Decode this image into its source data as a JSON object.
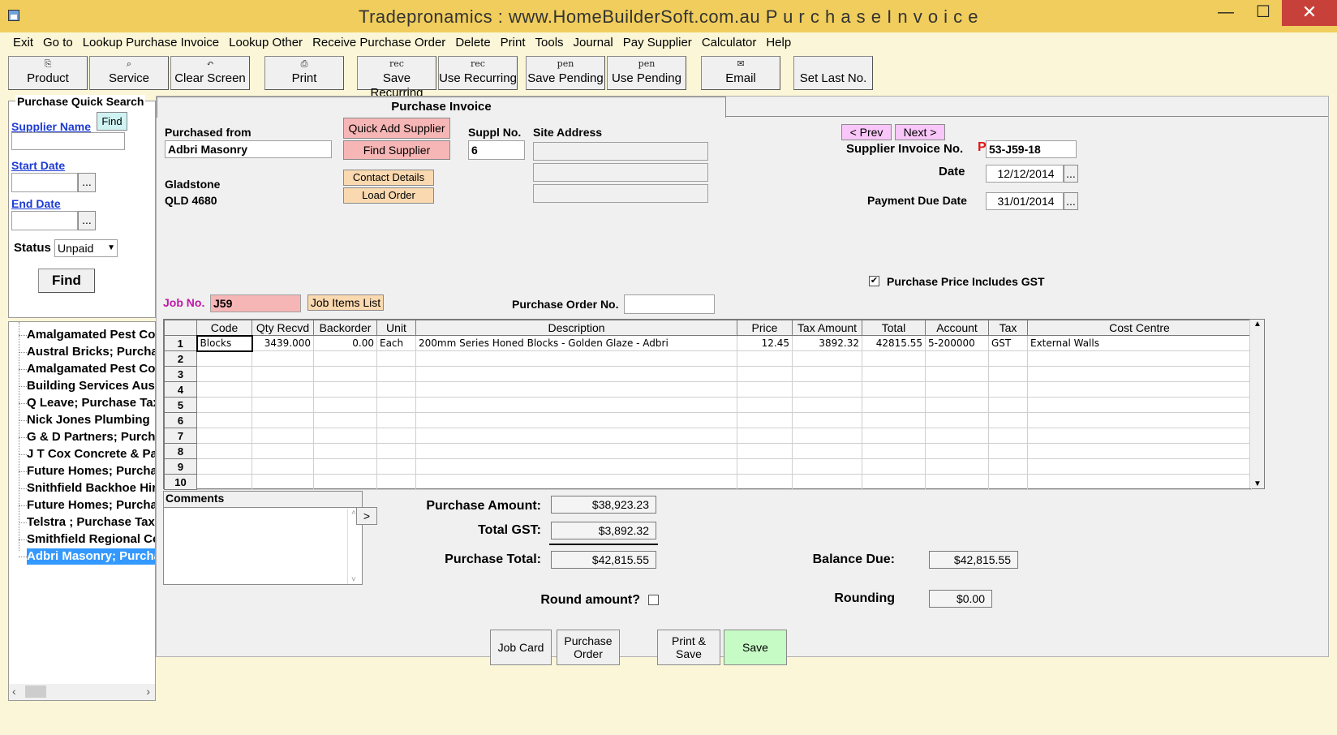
{
  "window": {
    "title": "Tradepronamics :   www.HomeBuilderSoft.com.au     P u r c h a s e   I n v o i c e",
    "minimize": "—",
    "maximize": "☐",
    "close": "✕"
  },
  "menu": [
    "Exit",
    "Go to",
    "Lookup Purchase Invoice",
    "Lookup Other",
    "Receive Purchase Order",
    "Delete",
    "Print",
    "Tools",
    "Journal",
    "Pay Supplier",
    "Calculator",
    "Help"
  ],
  "toolbar": [
    {
      "label": "Product",
      "icon": "⎘"
    },
    {
      "label": "Service",
      "icon": "⌕"
    },
    {
      "label": "Clear Screen",
      "icon": "↶"
    },
    {
      "label": "Print",
      "icon": "⎙"
    },
    {
      "label": "Save Recurring",
      "icon": "rec"
    },
    {
      "label": "Use Recurring",
      "icon": "rec"
    },
    {
      "label": "Save Pending",
      "icon": "pen"
    },
    {
      "label": "Use Pending",
      "icon": "pen"
    },
    {
      "label": "Email",
      "icon": "✉"
    },
    {
      "label": "Set Last No.",
      "icon": ""
    }
  ],
  "quick_search": {
    "title": "Purchase Quick Search",
    "supplier_label": "Supplier Name",
    "find_small": "Find",
    "start_date_label": "Start Date",
    "end_date_label": "End Date",
    "dots": "...",
    "status_label": "Status",
    "status_value": "Unpaid",
    "find_button": "Find"
  },
  "results": [
    "Amalgamated Pest Control; Purchase",
    "Austral Bricks; Purchase",
    "Amalgamated Pest Control; Purchase",
    "Building Services Australia",
    "Q Leave; Purchase Tax",
    "Nick Jones Plumbing",
    "G & D Partners; Purchase",
    "J T Cox Concrete & Paving",
    "Future Homes; Purchase",
    "Snithfield Backhoe Hire",
    "Future Homes; Purchase",
    "Telstra ; Purchase Tax",
    "Smithfield Regional Council",
    "Adbri Masonry; Purchase"
  ],
  "invoice": {
    "tab": "Purchase Invoice",
    "purchased_from_label": "Purchased from",
    "supplier_name": "Adbri Masonry",
    "quick_add": "Quick Add Supplier",
    "find_supplier": "Find Supplier",
    "contact_details": "Contact Details",
    "load_order": "Load Order",
    "suppl_no_label": "Suppl No.",
    "suppl_no": "6",
    "site_address_label": "Site Address",
    "address_line1": "Gladstone",
    "address_line2": "QLD  4680",
    "prev": "< Prev",
    "next": "Next >",
    "supplier_invoice_label": "Supplier Invoice No.",
    "p_marker": "P",
    "supplier_invoice_no": "53-J59-18",
    "date_label": "Date",
    "date": "12/12/2014",
    "due_label": "Payment Due Date",
    "due_date": "31/01/2014",
    "gst_check_label": "Purchase Price Includes GST",
    "gst_checked": "✔",
    "job_no_label": "Job No.",
    "job_no": "J59",
    "job_items": "Job Items List",
    "po_label": "Purchase Order No.",
    "po_value": ""
  },
  "grid": {
    "columns": [
      "Code",
      "Qty Recvd",
      "Backorder",
      "Unit",
      "Description",
      "Price",
      "Tax Amount",
      "Total",
      "Account",
      "Tax",
      "Cost Centre"
    ],
    "rows": [
      [
        "1",
        "Blocks",
        "3439.000",
        "0.00",
        "Each",
        "200mm Series Honed Blocks - Golden Glaze - Adbri",
        "12.45",
        "3892.32",
        "42815.55",
        "5-200000",
        "GST",
        "External Walls"
      ],
      [
        "2",
        "",
        "",
        "",
        "",
        "",
        "",
        "",
        "",
        "",
        "",
        ""
      ],
      [
        "3",
        "",
        "",
        "",
        "",
        "",
        "",
        "",
        "",
        "",
        "",
        ""
      ],
      [
        "4",
        "",
        "",
        "",
        "",
        "",
        "",
        "",
        "",
        "",
        "",
        ""
      ],
      [
        "5",
        "",
        "",
        "",
        "",
        "",
        "",
        "",
        "",
        "",
        "",
        ""
      ],
      [
        "6",
        "",
        "",
        "",
        "",
        "",
        "",
        "",
        "",
        "",
        "",
        ""
      ],
      [
        "7",
        "",
        "",
        "",
        "",
        "",
        "",
        "",
        "",
        "",
        "",
        ""
      ],
      [
        "8",
        "",
        "",
        "",
        "",
        "",
        "",
        "",
        "",
        "",
        "",
        ""
      ],
      [
        "9",
        "",
        "",
        "",
        "",
        "",
        "",
        "",
        "",
        "",
        "",
        ""
      ],
      [
        "10",
        "",
        "",
        "",
        "",
        "",
        "",
        "",
        "",
        "",
        "",
        ""
      ]
    ]
  },
  "totals": {
    "comments_label": "Comments",
    "expand": ">",
    "purchase_amount_label": "Purchase Amount:",
    "purchase_amount": "$38,923.23",
    "total_gst_label": "Total GST:",
    "total_gst": "$3,892.32",
    "purchase_total_label": "Purchase Total:",
    "purchase_total": "$42,815.55",
    "balance_label": "Balance Due:",
    "balance": "$42,815.55",
    "round_label": "Round amount?",
    "rounding_label": "Rounding",
    "rounding": "$0.00"
  },
  "bottom": {
    "job_card": "Job Card",
    "purchase_order_1": "Purchase",
    "purchase_order_2": "Order",
    "print_save": "Print & Save",
    "save": "Save"
  }
}
